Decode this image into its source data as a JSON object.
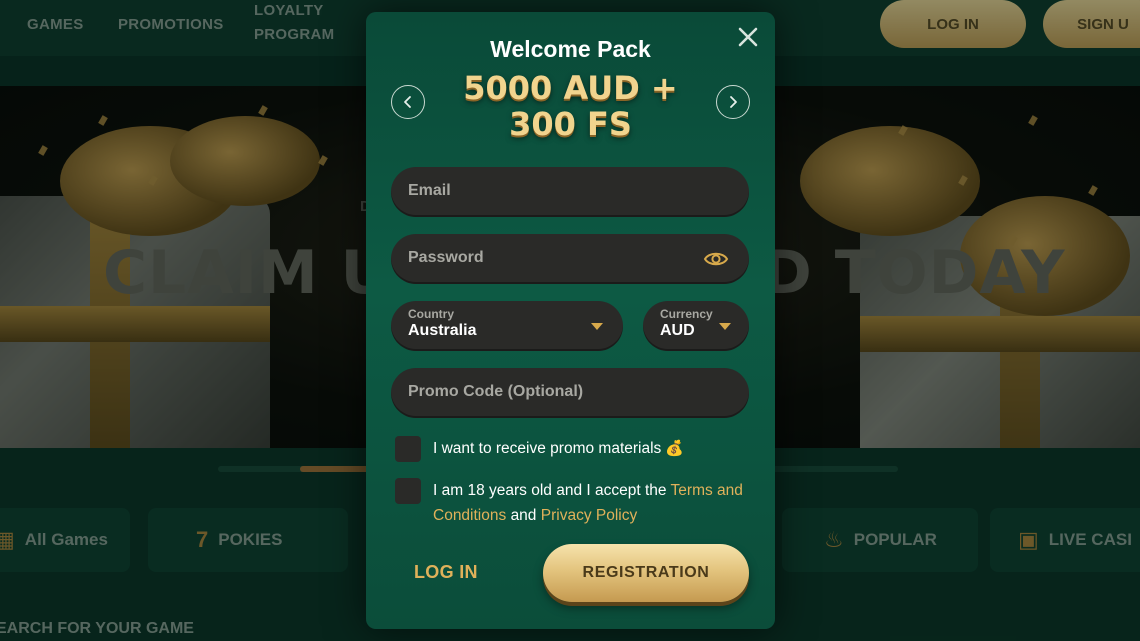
{
  "header": {
    "nav": [
      "GAMES",
      "PROMOTIONS",
      "LOYALTY",
      "PROGRAM"
    ],
    "login_label": "LOG IN",
    "signup_label": "SIGN U"
  },
  "hero": {
    "title_left": "CLAIM U",
    "title_right": "D TODAY",
    "sub": "D"
  },
  "categories": {
    "all_games": "All Games",
    "pokies": "POKIES",
    "popular": "POPULAR",
    "live_casino": "LIVE CASI"
  },
  "search_label": "EARCH FOR YOUR GAME",
  "modal": {
    "title": "Welcome Pack",
    "promo_line1": "5000 AUD +",
    "promo_line2": "300 FS",
    "email_placeholder": "Email",
    "password_placeholder": "Password",
    "country_label": "Country",
    "country_value": "Australia",
    "currency_label": "Currency",
    "currency_value": "AUD",
    "promo_code_placeholder": "Promo Code (Optional)",
    "promo_materials_text": "I want to receive promo materials",
    "age_text": "I am 18 years old and I accept the",
    "terms_link": "Terms and Conditions",
    "and_text": "and",
    "privacy_link": "Privacy Policy",
    "login_label": "LOG IN",
    "register_label": "REGISTRATION"
  },
  "colors": {
    "modal_green": "#0d5a44",
    "gold": "#e0b15a",
    "field_bg": "#2a2a28"
  },
  "icons": {
    "close": "close-icon",
    "prev": "chevron-left-icon",
    "next": "chevron-right-icon",
    "eye": "eye-icon",
    "bag": "money-bag-icon"
  }
}
